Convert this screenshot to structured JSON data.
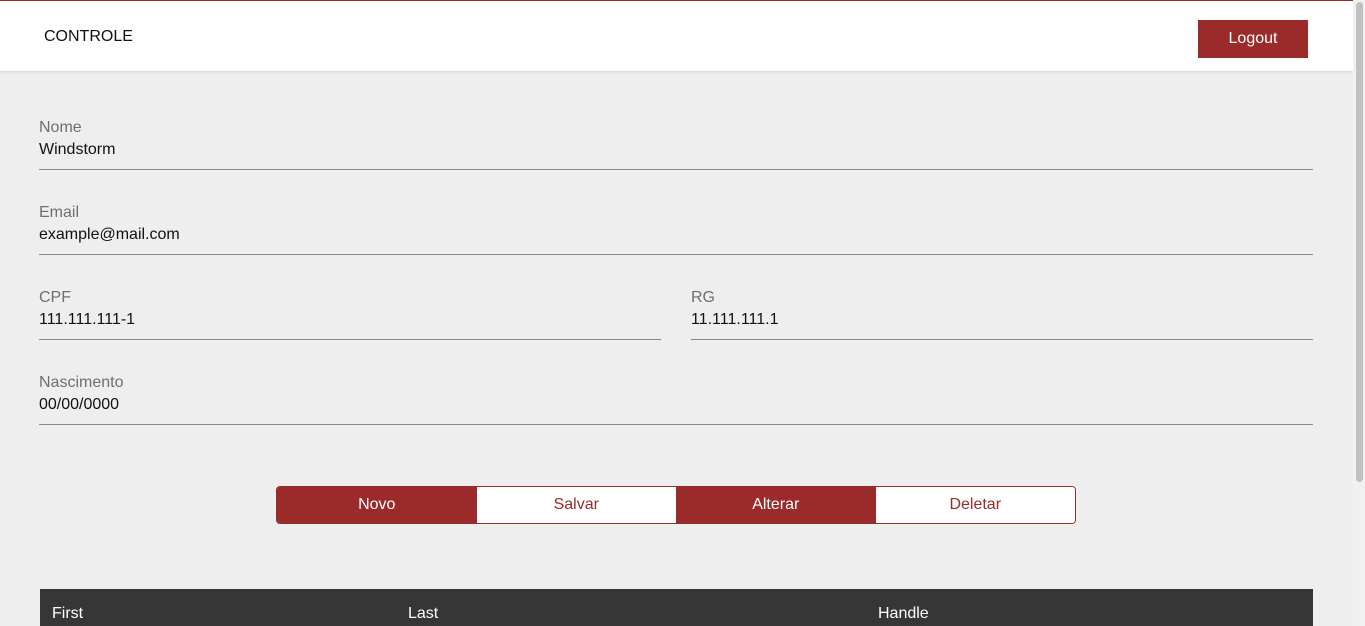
{
  "header": {
    "brand": "CONTROLE",
    "logout_label": "Logout"
  },
  "form": {
    "nome": {
      "label": "Nome",
      "value": "Windstorm"
    },
    "email": {
      "label": "Email",
      "value": "example@mail.com"
    },
    "cpf": {
      "label": "CPF",
      "value": "111.111.111-1"
    },
    "rg": {
      "label": "RG",
      "value": "11.111.111.1"
    },
    "nascimento": {
      "label": "Nascimento",
      "value": "00/00/0000"
    }
  },
  "actions": {
    "novo": "Novo",
    "salvar": "Salvar",
    "alterar": "Alterar",
    "deletar": "Deletar"
  },
  "table": {
    "columns": [
      "First",
      "Last",
      "Handle"
    ]
  },
  "colors": {
    "accent": "#9b2a2a",
    "table_header_bg": "#363636",
    "page_bg": "#eeeeee"
  }
}
